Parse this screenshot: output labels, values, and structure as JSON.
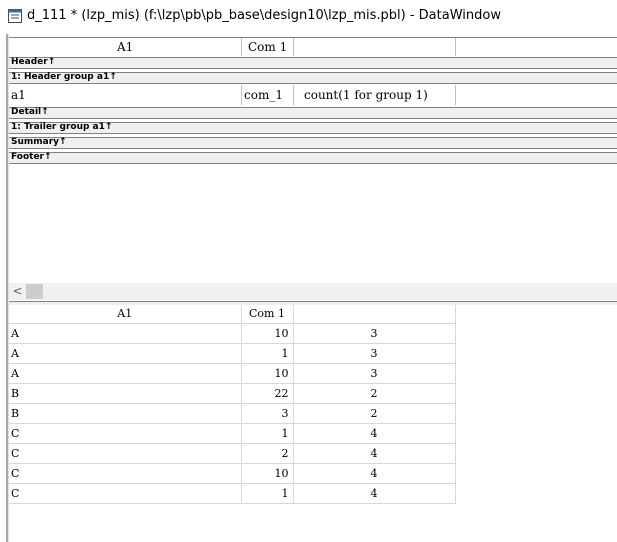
{
  "window": {
    "title": "d_111 * (lzp_mis) (f:\\lzp\\pb\\pb_base\\design10\\lzp_mis.pbl) - DataWindow"
  },
  "design": {
    "header_labels": [
      "A1",
      "Com 1"
    ],
    "bands": {
      "header": "Header↑",
      "header_group": "1: Header group a1↑",
      "detail": "Detail↑",
      "trailer_group": "1: Trailer group a1↑",
      "summary": "Summary↑",
      "footer": "Footer↑"
    },
    "detail_fields": [
      "a1",
      "com_1",
      "count(1 for group 1)"
    ]
  },
  "scrollbar": {
    "left_arrow": "<"
  },
  "preview": {
    "columns": [
      "A1",
      "Com 1",
      ""
    ],
    "rows": [
      [
        "A",
        "10",
        "3"
      ],
      [
        "A",
        "1",
        "3"
      ],
      [
        "A",
        "10",
        "3"
      ],
      [
        "B",
        "22",
        "2"
      ],
      [
        "B",
        "3",
        "2"
      ],
      [
        "C",
        "1",
        "4"
      ],
      [
        "C",
        "2",
        "4"
      ],
      [
        "C",
        "10",
        "4"
      ],
      [
        "C",
        "1",
        "4"
      ]
    ]
  }
}
